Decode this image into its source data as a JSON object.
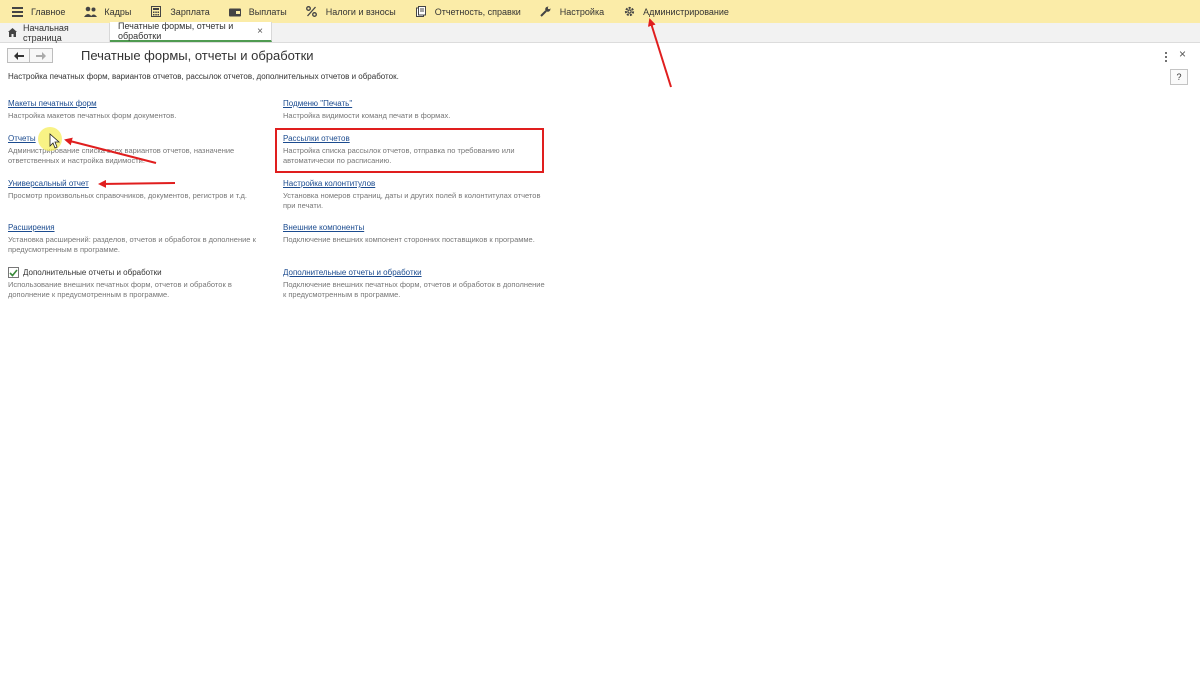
{
  "menubar": {
    "items": [
      {
        "label": "Главное",
        "icon": "hamburger-icon"
      },
      {
        "label": "Кадры",
        "icon": "people-icon"
      },
      {
        "label": "Зарплата",
        "icon": "calculator-icon"
      },
      {
        "label": "Выплаты",
        "icon": "wallet-icon"
      },
      {
        "label": "Налоги и взносы",
        "icon": "percent-icon"
      },
      {
        "label": "Отчетность, справки",
        "icon": "documents-icon"
      },
      {
        "label": "Настройка",
        "icon": "wrench-icon"
      },
      {
        "label": "Администрирование",
        "icon": "gear-icon"
      }
    ],
    "background": "#fbeca8"
  },
  "tabs": {
    "home_label": "Начальная страница",
    "active_label": "Печатные формы, отчеты и обработки",
    "close_label": "×"
  },
  "header": {
    "title": "Печатные формы, отчеты и обработки",
    "close_label": "×",
    "help_label": "?",
    "description": "Настройка печатных форм, вариантов отчетов, рассылок отчетов, дополнительных отчетов и обработок."
  },
  "left_items": [
    {
      "title": "Макеты печатных форм",
      "description": "Настройка макетов печатных форм документов."
    },
    {
      "title": "Отчеты",
      "description": "Администрирование списка всех вариантов отчетов, назначение ответственных и настройка видимости."
    },
    {
      "title": "Универсальный отчет",
      "description": "Просмотр произвольных справочников, документов, регистров и т.д."
    },
    {
      "title": "Расширения",
      "description": "Установка расширений: разделов, отчетов и обработок в дополнение к предусмотренным в программе."
    },
    {
      "title": "Дополнительные отчеты и обработки",
      "description": "Использование внешних печатных форм, отчетов и обработок в дополнение к предусмотренным в программе.",
      "checked": true
    }
  ],
  "right_items": [
    {
      "title": "Подменю \"Печать\"",
      "description": "Настройка видимости команд печати в формах."
    },
    {
      "title": "Рассылки отчетов",
      "description": "Настройка списка рассылок отчетов, отправка по требованию или автоматически по расписанию."
    },
    {
      "title": "Настройка колонтитулов",
      "description": "Установка номеров страниц, даты и других полей в колонтитулах отчетов при печати."
    },
    {
      "title": "Внешние компоненты",
      "description": "Подключение внешних компонент сторонних поставщиков к программе."
    },
    {
      "title": "Дополнительные отчеты и обработки",
      "description": "Подключение внешних печатных форм, отчетов и обработок в дополнение к предусмотренным в программе."
    }
  ],
  "colors": {
    "link": "#1b4b8f",
    "annotation": "#e01e1e",
    "active_tab_underline": "#4f9b51"
  }
}
